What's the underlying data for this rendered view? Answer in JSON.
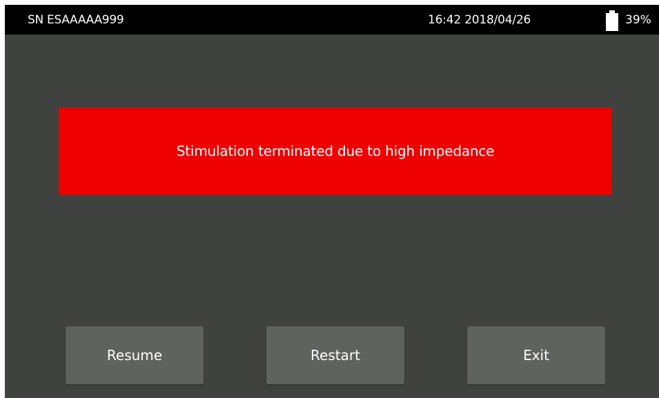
{
  "status_bar": {
    "serial": "SN ESAAAAA999",
    "datetime": "16:42 2018/04/26",
    "battery_icon": "battery-icon",
    "battery_percent": "39%"
  },
  "alert": {
    "message": "Stimulation terminated due to high impedance",
    "color": "#ee0000"
  },
  "buttons": {
    "resume": "Resume",
    "restart": "Restart",
    "exit": "Exit"
  },
  "colors": {
    "background": "#3f423f",
    "status_bar": "#000000",
    "button": "#5f635f",
    "text": "#ffffff"
  }
}
